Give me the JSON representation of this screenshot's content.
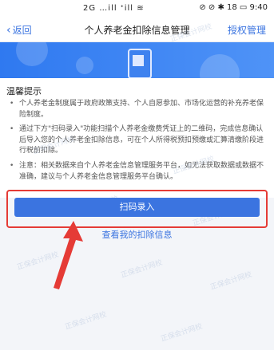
{
  "status": {
    "left": "2G …ill ᐩill ≋",
    "right": "⊘ ⊘ ✱ 18 ▭ 9:40"
  },
  "nav": {
    "back": "返回",
    "title": "个人养老金扣除信息管理",
    "right": "授权管理"
  },
  "tips": {
    "title": "温馨提示",
    "items": [
      "个人养老金制度属于政府政策支持、个人自愿参加、市场化运营的补充养老保险制度。",
      "通过下方\"扫码录入\"功能扫描个人养老金缴费凭证上的二维码，完成信息确认后导入您的个人养老金扣除信息，可在个人所得税预扣预缴或汇算清缴阶段进行税前扣除。",
      "注意：相关数据来自个人养老金信息管理服务平台，如无法获取数据或数据不准确，建议与个人养老金信息管理服务平台确认。"
    ]
  },
  "actions": {
    "scan": "扫码录入",
    "view": "查看我的扣除信息"
  },
  "watermark": "正保会计网校",
  "colors": {
    "accent": "#3b74e0",
    "callout": "#e53b36"
  }
}
